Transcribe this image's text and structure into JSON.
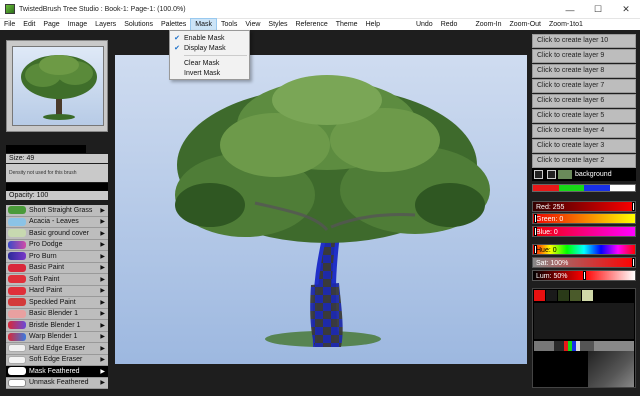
{
  "window": {
    "title": "TwistedBrush Tree Studio : Book-1: Page-1:  (100.0%)",
    "minimize": "—",
    "maximize": "☐",
    "close": "✕"
  },
  "menu": {
    "items": [
      "File",
      "Edit",
      "Page",
      "Image",
      "Layers",
      "Solutions",
      "Palettes",
      "Mask",
      "Tools",
      "View",
      "Styles",
      "Reference",
      "Theme",
      "Help"
    ],
    "actions": [
      "Undo",
      "Redo",
      "Zoom-In",
      "Zoom-Out",
      "Zoom-1to1"
    ]
  },
  "mask_menu": {
    "items": [
      {
        "label": "Enable Mask",
        "checked": true
      },
      {
        "label": "Display Mask",
        "checked": true
      },
      {
        "label": "Clear Mask",
        "checked": false
      },
      {
        "label": "Invert Mask",
        "checked": false
      }
    ]
  },
  "brush_settings": {
    "size": "Size: 49",
    "density": "Density not used for this brush",
    "opacity": "Opacity: 100"
  },
  "brushes": [
    {
      "label": "Short Straight Grass",
      "color": "#4a9a3a"
    },
    {
      "label": "Acacia - Leaves",
      "color": "#8bc3e6"
    },
    {
      "label": "Basic ground cover",
      "color": "#c7d9b0"
    },
    {
      "label": "Pro Dodge",
      "color": "#b04cc8"
    },
    {
      "label": "Pro Burn",
      "color": "#5a3aa8"
    },
    {
      "label": "Basic Paint",
      "color": "#d9283a"
    },
    {
      "label": "Soft Paint",
      "color": "#e0303a"
    },
    {
      "label": "Hard Paint",
      "color": "#e0303a"
    },
    {
      "label": "Speckled Paint",
      "color": "#d33a3a"
    },
    {
      "label": "Basic Blender 1",
      "color": "#e8a0a0"
    },
    {
      "label": "Bristle Blender 1",
      "color": "#6a4ad8"
    },
    {
      "label": "Warp Blender 1",
      "color": "#3a7ae0"
    },
    {
      "label": "Hard Edge Eraser",
      "color": "#f0f0f0"
    },
    {
      "label": "Soft Edge Eraser",
      "color": "#f4f4f4"
    },
    {
      "label": "Mask Feathered",
      "color": "#ffffff",
      "selected": true
    },
    {
      "label": "Unmask Feathered",
      "color": "#ffffff"
    }
  ],
  "layers": [
    "Click to create layer 10",
    "Click to create layer 9",
    "Click to create layer 8",
    "Click to create layer 7",
    "Click to create layer 6",
    "Click to create layer 5",
    "Click to create layer 4",
    "Click to create layer 3",
    "Click to create layer 2"
  ],
  "background_layer": "background",
  "color_swatches": [
    "#e81818",
    "#18d818",
    "#1830e8",
    "#ffffff"
  ],
  "color_controls": {
    "red": {
      "label": "Red: 255",
      "value": 255
    },
    "green": {
      "label": "Green: 0",
      "value": 0
    },
    "blue": {
      "label": "Blue: 0",
      "value": 0
    },
    "hue": {
      "label": "Hue: 0",
      "value": 0
    },
    "sat": {
      "label": "Sat: 100%",
      "value": 100
    },
    "lum": {
      "label": "Lum: 50%",
      "value": 50
    }
  },
  "palette_colors": [
    "#e81010",
    "#1a1a1a",
    "#2a3a18",
    "#4a5a2a",
    "#cfd8a8"
  ]
}
